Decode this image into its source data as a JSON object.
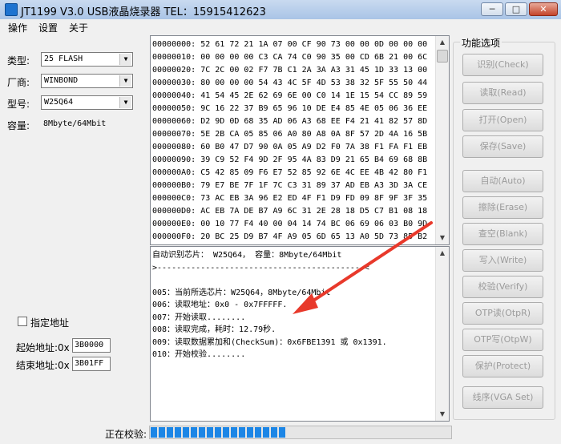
{
  "window": {
    "title": "JT1199 V3.0 USB液晶烧录器    TEL：15915412623",
    "controls": {
      "minimize": "─",
      "maximize": "□",
      "close": "✕"
    }
  },
  "menu": [
    "操作",
    "设置",
    "关于"
  ],
  "left": {
    "type_label": "类型:",
    "type_value": "25 FLASH",
    "vendor_label": "厂商:",
    "vendor_value": "WINBOND",
    "model_label": "型号:",
    "model_value": "W25Q64",
    "capacity_label": "容量:",
    "capacity_value": "8Mbyte/64Mbit",
    "specify_address_label": "指定地址",
    "start_label": "起始地址:0x",
    "start_value": "3B0000",
    "end_label": "结束地址:0x",
    "end_value": "3B01FF"
  },
  "hex": [
    "00000000: 52 61 72 21 1A 07 00 CF 90 73 00 00 0D 00 00 00",
    "00000010: 00 00 00 00 C3 CA 74 C0 90 35 00 CD 6B 21 00 6C",
    "00000020: 7C 2C 00 02 F7 7B C1 2A 3A A3 31 45 1D 33 13 00",
    "00000030: 80 00 00 00 54 43 4C 5F 4D 53 38 32 5F 55 50 44",
    "00000040: 41 54 45 2E 62 69 6E 00 C0 14 1E 15 54 CC 89 59",
    "00000050: 9C 16 22 37 B9 65 96 10 DE E4 85 4E 05 06 36 EE",
    "00000060: D2 9D 0D 68 35 AD 06 A3 68 EE F4 21 41 82 57 8D",
    "00000070: 5E 2B CA 05 85 06 A0 80 A8 0A 8F 57 2D 4A 16 5B",
    "00000080: 60 B0 47 D7 90 0A 05 A9 D2 F0 7A 38 F1 FA F1 EB",
    "00000090: 39 C9 52 F4 9D 2F 95 4A 83 D9 21 65 B4 69 68 8B",
    "000000A0: C5 42 85 09 F6 E7 52 85 92 6E 4C EE 4B 42 80 F1",
    "000000B0: 79 E7 BE 7F 1F 7C C3 31 89 37 AD EB A3 3D 3A CE",
    "000000C0: 73 AC EB 3A 96 E2 ED 4F F1 D9 FD 09 8F 9F 3F 35",
    "000000D0: AC EB 7A DE B7 A9 6C 31 2E 28 18 D5 C7 B1 08 18",
    "000000E0: 00 10 77 F4 40 00 04 14 74 BC 06 69 06 03 B0 9D",
    "000000F0: 20 BC 25 D9 B7 4F A9 05 6D 65 13 A0 5D 73 85 B2"
  ],
  "log": [
    "自动识别芯片： W25Q64， 容量：8Mbyte/64Mbit",
    ">-------------------------------------------<",
    "",
    "005：当前所选芯片：W25Q64，8Mbyte/64Mbit",
    "006：读取地址：0x0 - 0x7FFFFF.",
    "007：开始读取........",
    "008：读取完成，耗时：12.79秒.",
    "009：读取数据累加和(CheckSum)：0x6FBE1391 或 0x1391.",
    "010：开始校验........"
  ],
  "functions": {
    "title": "功能选项",
    "buttons": [
      "识别(Check)",
      "读取(Read)",
      "打开(Open)",
      "保存(Save)",
      "自动(Auto)",
      "擦除(Erase)",
      "查空(Blank)",
      "写入(Write)",
      "校验(Verify)",
      "OTP读(OtpR)",
      "OTP写(OtpW)",
      "保护(Protect)",
      "线序(VGA Set)"
    ]
  },
  "status": {
    "label": "正在校验:",
    "progress": 0.45
  },
  "colors": {
    "progress": "#1c86e6",
    "annotation_arrow": "#e8392b"
  }
}
